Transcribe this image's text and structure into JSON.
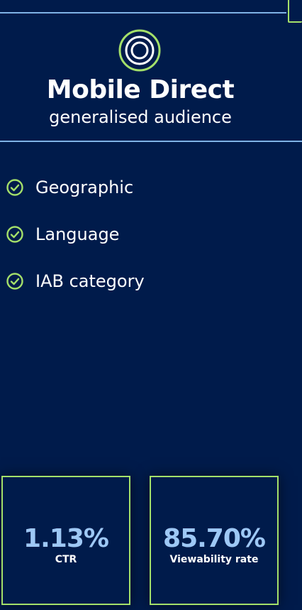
{
  "header": {
    "title": "Mobile Direct",
    "subtitle": "generalised audience",
    "logo_icon": "concentric-circles-icon"
  },
  "features": [
    {
      "label": "Geographic",
      "icon": "check-circle-icon"
    },
    {
      "label": "Language",
      "icon": "check-circle-icon"
    },
    {
      "label": "IAB category",
      "icon": "check-circle-icon"
    }
  ],
  "stats": [
    {
      "value": "1.13%",
      "label": "CTR"
    },
    {
      "value": "85.70%",
      "label": "Viewability rate"
    }
  ],
  "colors": {
    "background": "#001b4b",
    "accent_green": "#a4e06a",
    "accent_blue": "#9ec8f5",
    "line_blue": "#7fb2e6",
    "text": "#ffffff"
  }
}
